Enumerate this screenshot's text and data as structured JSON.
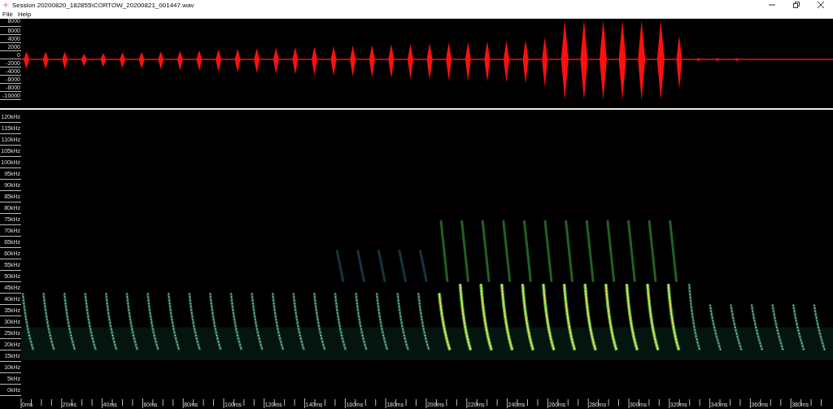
{
  "window": {
    "title": "Session 20200820_182855\\CORTOW_20200821_001447.wav"
  },
  "menu": [
    "File",
    "Help"
  ],
  "waveform": {
    "y_labels": [
      "8000",
      "6000",
      "4000",
      "2000",
      "0",
      "-2000",
      "-4000",
      "-6000",
      "-8000",
      "-10000"
    ]
  },
  "spectrogram": {
    "y_labels": [
      "120kHz",
      "115kHz",
      "110kHz",
      "105kHz",
      "100kHz",
      "95kHz",
      "90kHz",
      "85kHz",
      "80kHz",
      "75kHz",
      "70kHz",
      "65kHz",
      "60kHz",
      "55kHz",
      "50kHz",
      "45kHz",
      "40kHz",
      "35kHz",
      "30kHz",
      "25kHz",
      "20kHz",
      "15kHz",
      "10kHz",
      "5kHz",
      "0kHz"
    ]
  },
  "time_axis": {
    "labels": [
      "0ms",
      "20ms",
      "40ms",
      "60ms",
      "80ms",
      "100ms",
      "120ms",
      "140ms",
      "160ms",
      "180ms",
      "200ms",
      "220ms",
      "240ms",
      "260ms",
      "280ms",
      "300ms",
      "320ms",
      "340ms",
      "360ms",
      "380ms"
    ]
  }
}
